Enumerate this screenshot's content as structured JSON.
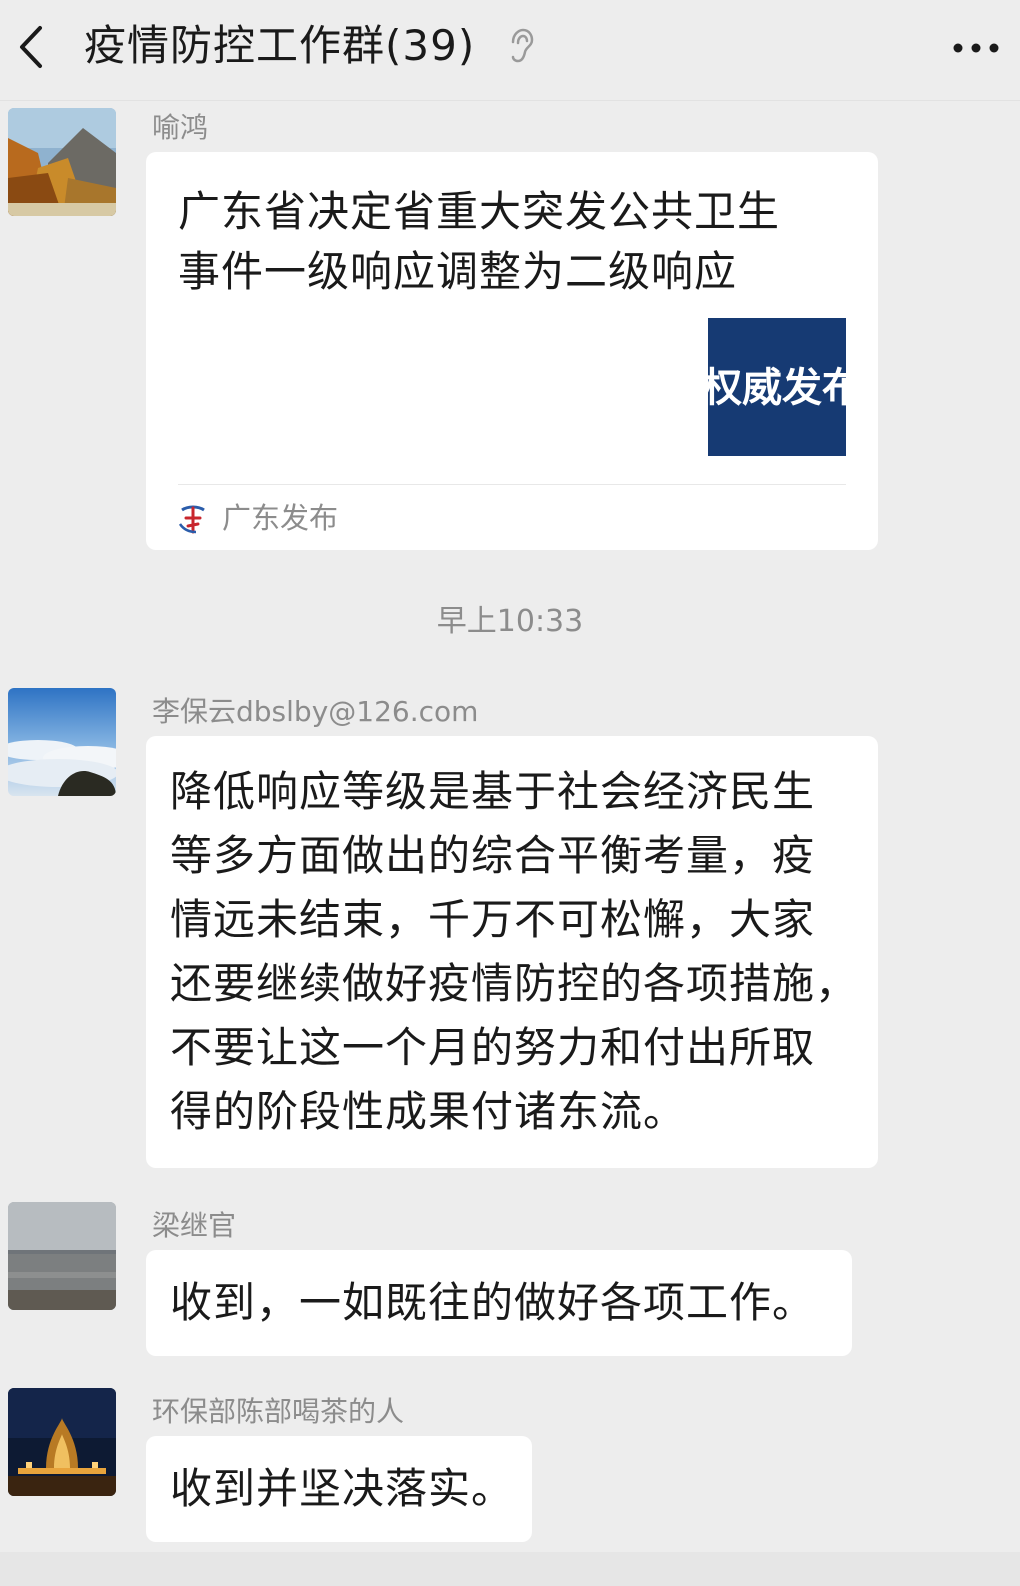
{
  "header": {
    "title": "疫情防控工作群(39)"
  },
  "icons": {
    "back": "chevron-left-icon",
    "mute": "ear-icon",
    "more": "more-dots-icon",
    "source": "guangdong-fabu-logo-icon"
  },
  "messages": [
    {
      "sender": "喻鸿",
      "card": {
        "title_lines": [
          "广东省决定省重大突发公共卫生",
          "事件一级响应调整为二级响应"
        ],
        "thumb_text": "权威发布",
        "source": "广东发布"
      }
    },
    {
      "sender": "李保云dbslby@126.com",
      "lines": [
        "降低响应等级是基于社会经济民生",
        "等多方面做出的综合平衡考量，疫",
        "情远未结束，千万不可松懈，大家",
        "还要继续做好疫情防控的各项措施，",
        "不要让这一个月的努力和付出所取",
        "得的阶段性成果付诸东流。"
      ]
    },
    {
      "sender": "梁继官",
      "text": "收到，一如既往的做好各项工作。"
    },
    {
      "sender": "环保部陈部喝茶的人",
      "text": "收到并坚决落实。"
    }
  ],
  "timestamp": "早上10:33",
  "colors": {
    "background": "#ededed",
    "bubble": "#ffffff",
    "card_thumb": "#163a73",
    "muted_text": "#8c8c8c"
  }
}
